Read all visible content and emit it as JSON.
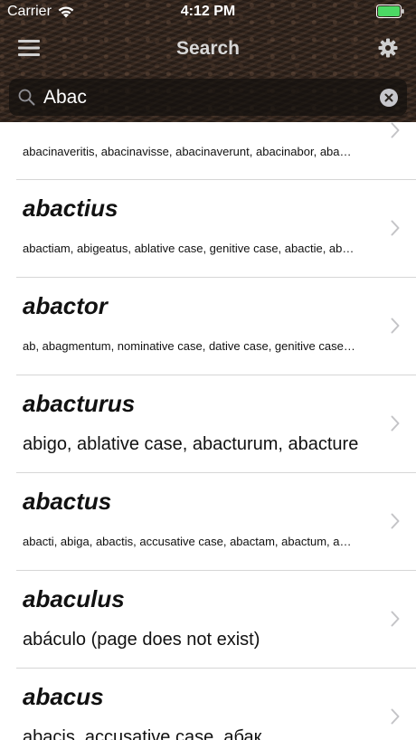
{
  "status": {
    "carrier": "Carrier",
    "time": "4:12 PM"
  },
  "nav": {
    "title": "Search"
  },
  "search": {
    "value": "Abac"
  },
  "results": [
    {
      "title": "",
      "subtitle": "abacinaveritis, abacinavisse, abacinaverunt, abacinabor, abacinabimini, abacinabitur"
    },
    {
      "title": "abactius",
      "subtitle": "abactiam, abigeatus, ablative case, genitive case, abactie, abactiis, abactiorum"
    },
    {
      "title": "abactor",
      "subtitle": "ab, abagmentum, nominative case, dative case, genitive case, accusative case"
    },
    {
      "title": "abacturus",
      "subtitle": "abigo, ablative case, abacturum, abacture"
    },
    {
      "title": "abactus",
      "subtitle": "abacti, abiga, abactis, accusative case, abactam, abactum, abactorum"
    },
    {
      "title": "abaculus",
      "subtitle": "abáculo (page does not exist)"
    },
    {
      "title": "abacus",
      "subtitle": "abacis, accusative case, абак"
    }
  ],
  "colors": {
    "header": "#2e231c",
    "title": "#d7d7d7",
    "divider": "#d6d6d6",
    "chevron": "#c4c4c7",
    "battery": "#4cd964"
  }
}
